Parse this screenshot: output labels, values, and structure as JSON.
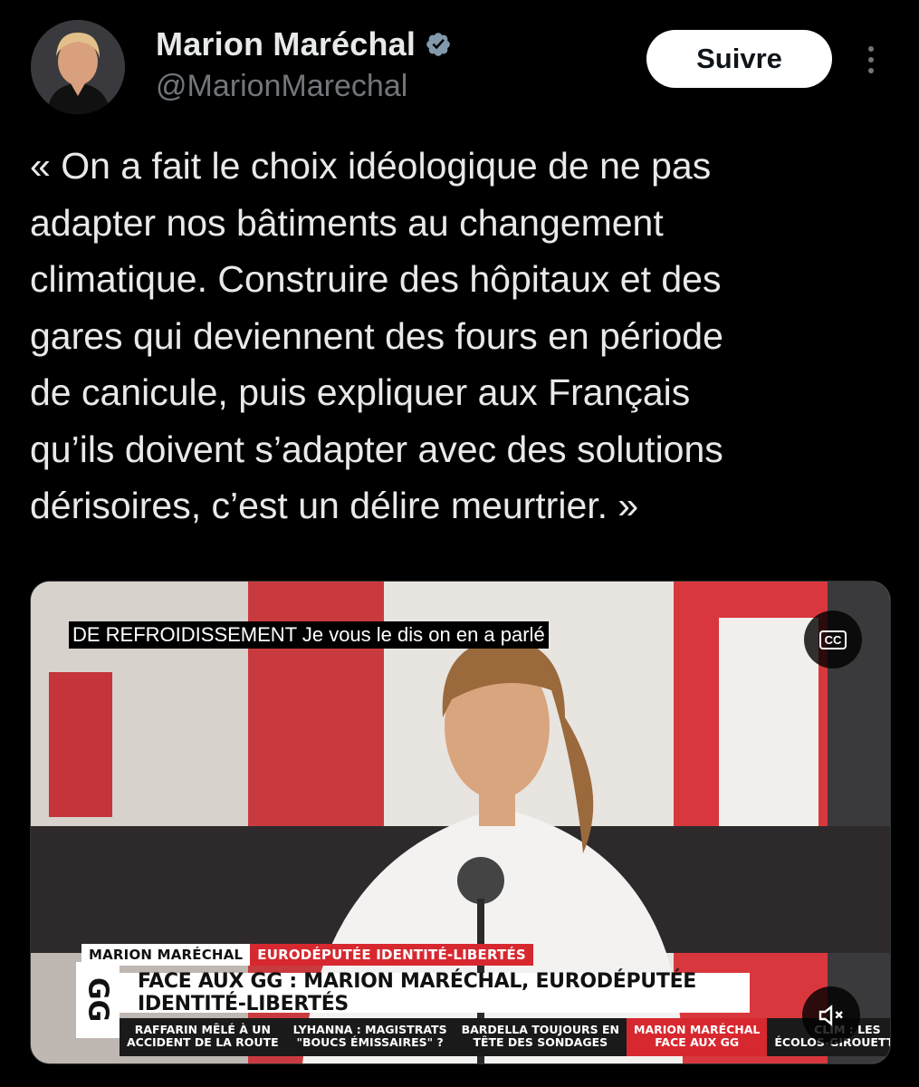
{
  "author": {
    "display_name": "Marion Maréchal",
    "handle": "@MarionMarechal",
    "verified": true
  },
  "actions": {
    "follow_label": "Suivre",
    "more_icon": "more-vertical-icon"
  },
  "tweet": {
    "lines": [
      "« On a fait le choix idéologique de ne pas",
      "adapter nos bâtiments au changement",
      "climatique. Construire des hôpitaux et des",
      "gares qui deviennent des fours en période",
      "de canicule, puis expliquer aux Français",
      "qu’ils doivent s’adapter avec des solutions",
      "dérisoires, c’est un délire meurtrier. »"
    ]
  },
  "video": {
    "caption": "DE REFROIDISSEMENT Je vous le dis on en a parlé",
    "cc_label": "CC",
    "lower_third": {
      "name": "MARION MARÉCHAL",
      "role": "EURODÉPUTÉE IDENTITÉ-LIBERTÉS",
      "title": "FACE AUX GG : MARION MARÉCHAL, EURODÉPUTÉE IDENTITÉ-LIBERTÉS",
      "logo": "GG"
    },
    "ticker": [
      {
        "line1": "RAFFARIN MÊLÉ À UN",
        "line2": "ACCIDENT DE LA ROUTE",
        "highlight": false
      },
      {
        "line1": "LYHANNA : MAGISTRATS",
        "line2": "\"BOUCS ÉMISSAIRES\" ?",
        "highlight": false
      },
      {
        "line1": "BARDELLA TOUJOURS EN",
        "line2": "TÊTE DES SONDAGES",
        "highlight": false
      },
      {
        "line1": "MARION MARÉCHAL",
        "line2": "FACE AUX GG",
        "highlight": true
      },
      {
        "line1": "CLIM : LES",
        "line2": "ÉCOLOS-GIROUETTES ?",
        "highlight": false
      }
    ],
    "mute_icon": "volume-muted-icon"
  },
  "colors": {
    "background": "#000000",
    "text_primary": "#e7e9ea",
    "text_secondary": "#71767b",
    "verified": "#829aab",
    "tv_red": "#d7282f"
  }
}
